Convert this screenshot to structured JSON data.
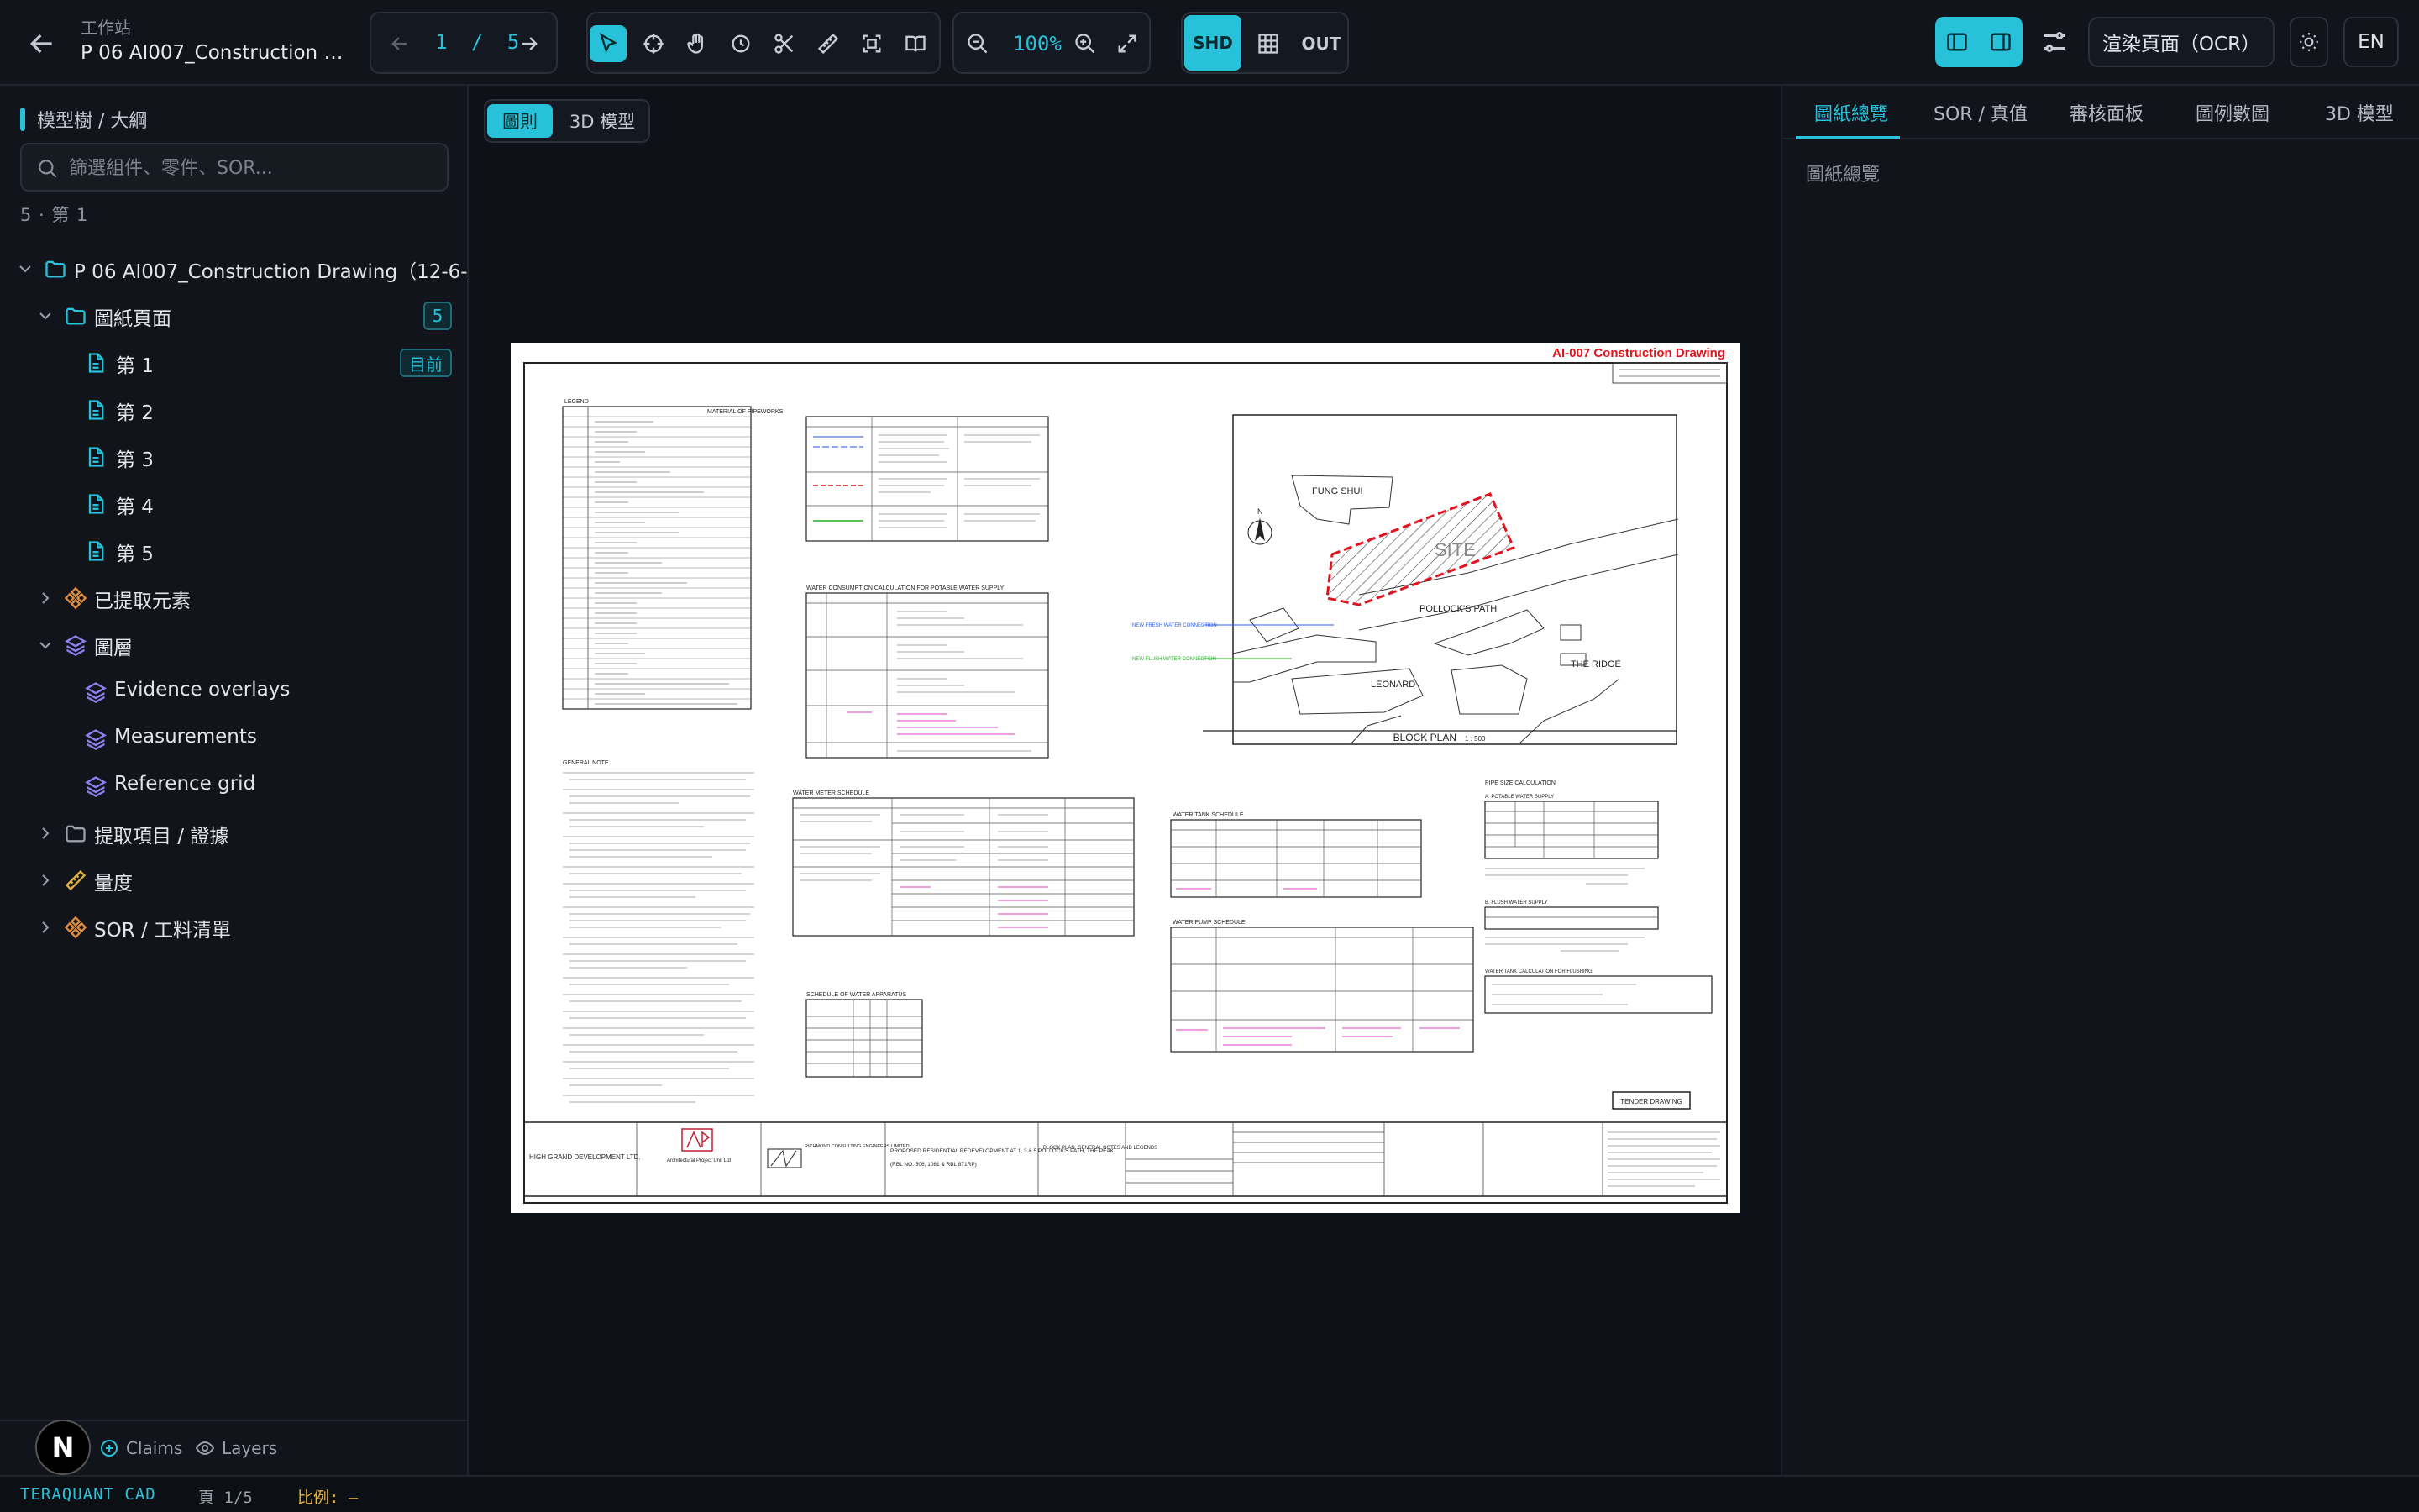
{
  "header": {
    "workspace_label": "工作站",
    "title": "P 06 AI007_Construction Dr...",
    "page_current": "1",
    "page_sep": "/",
    "page_total": "5",
    "zoom": "100%",
    "modes": [
      "SHD",
      "OUT"
    ],
    "render_button": "渲染頁面（OCR）",
    "lang_button": "EN"
  },
  "sidebar": {
    "heading": "模型樹 / 大綱",
    "search_placeholder": "篩選組件、零件、SOR...",
    "count": "5 · 第 1",
    "root": "P 06 AI007_Construction Drawing（12-6-...",
    "pages_group": "圖紙頁面",
    "pages_count": "5",
    "current_badge": "目前",
    "pages": [
      "第 1",
      "第 2",
      "第 3",
      "第 4",
      "第 5"
    ],
    "extracted": "已提取元素",
    "layers_group": "圖層",
    "layers": [
      "Evidence overlays",
      "Measurements",
      "Reference grid"
    ],
    "claims": "提取項目 / 證據",
    "quantities": "量度",
    "sor": "SOR / 工料清單"
  },
  "footer": {
    "claims": "Claims",
    "layers": "Layers",
    "avatar_letter": "N"
  },
  "statusbar": {
    "brand": "TERAQUANT CAD",
    "page": "頁 1/5",
    "scale": "比例: —"
  },
  "center": {
    "tabs": [
      "圖則",
      "3D 模型"
    ]
  },
  "drawing": {
    "title": "AI-007 Construction Drawing",
    "legend": "LEGEND",
    "materials": "MATERIAL OF PIPEWORKS",
    "water_consumption": "WATER CONSUMPTION CALCULATION FOR POTABLE WATER SUPPLY",
    "general_notes": "GENERAL NOTE",
    "water_meter": "WATER METER SCHEDULE",
    "water_tank": "WATER TANK SCHEDULE",
    "water_pump": "WATER PUMP SCHEDULE",
    "fitments": "SCHEDULE OF WATER APPARATUS",
    "pipe_size": "PIPE SIZE CALCULATION",
    "potable": "A. POTABLE WATER SUPPLY",
    "flush": "B. FLUSH WATER SUPPLY",
    "tank_calc": "WATER TANK CALCULATION FOR FLUSHING",
    "fung_shui": "FUNG SHUI",
    "site": "SITE",
    "pollocks": "POLLOCK'S PATH",
    "leonard": "LEONARD",
    "ridge": "THE RIDGE",
    "block_plan": "BLOCK PLAN",
    "block_scale": "1 : 500",
    "fresh_conn": "NEW FRESH WATER CONNECTION",
    "flush_conn": "NEW FLUSH WATER CONNECTION",
    "tender": "TENDER DRAWING",
    "client": "HIGH GRAND DEVELOPMENT LTD.",
    "architect": "Architectural Project Unit Ltd",
    "consultant": "RICHMOND CONSULTING ENGINEERS LIMITED",
    "project": "PROPOSED RESIDENTIAL REDEVELOPMENT AT 1, 3 & 5 POLLOCK'S PATH, THE PEAK",
    "lot": "(RBL NO. 506, 1081 & RBL 871RP)",
    "sheet_title": "BLOCK PLAN, GENERAL NOTES AND LEGENDS",
    "north": "N"
  },
  "rpanel": {
    "tabs": [
      "圖紙總覽",
      "SOR / 真值",
      "審核面板",
      "圖例數圖",
      "3D 模型"
    ],
    "title": "圖紙總覽"
  },
  "colors": {
    "accent": "#27c2d9",
    "bg": "#0e1117",
    "panel": "#11141a",
    "drawing_red": "#e0141e"
  }
}
